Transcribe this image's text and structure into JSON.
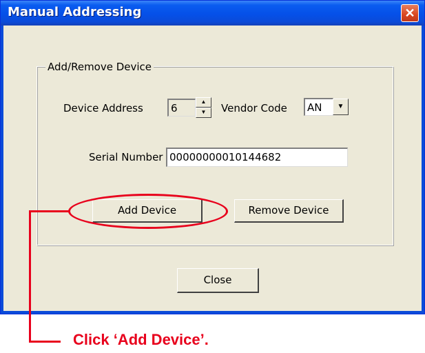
{
  "window": {
    "title": "Manual Addressing",
    "close_glyph": "✕"
  },
  "group": {
    "title": "Add/Remove Device",
    "device_address_label": "Device Address",
    "device_address_value": "6",
    "spin_up_glyph": "▲",
    "spin_down_glyph": "▼",
    "vendor_code_label": "Vendor Code",
    "vendor_code_value": "AN",
    "dropdown_glyph": "▼",
    "serial_number_label": "Serial Number",
    "serial_number_value": "00000000010144682",
    "add_device_label": "Add Device",
    "remove_device_label": "Remove Device"
  },
  "close_button_label": "Close",
  "annotation": {
    "text": "Click ‘Add Device’.",
    "color": "#e8001c"
  },
  "colors": {
    "titlebar": "#0550e8",
    "dialog_bg": "#ece9d8"
  }
}
